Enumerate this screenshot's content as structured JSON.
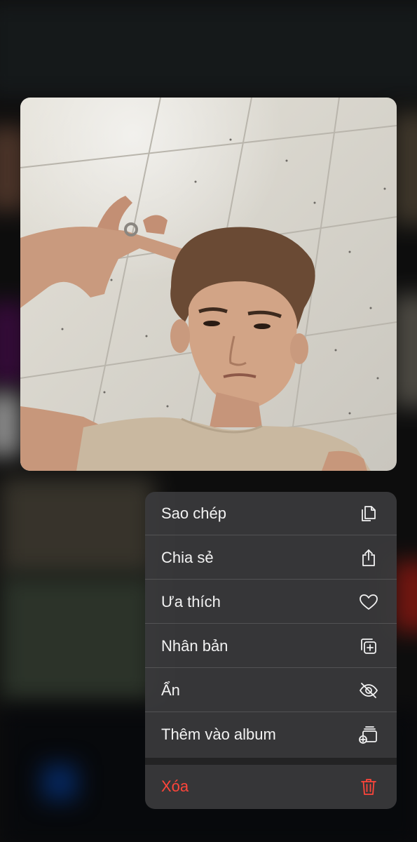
{
  "menu": {
    "items": [
      {
        "label": "Sao chép",
        "icon": "copy-icon"
      },
      {
        "label": "Chia sẻ",
        "icon": "share-icon"
      },
      {
        "label": "Ưa thích",
        "icon": "heart-icon"
      },
      {
        "label": "Nhân bản",
        "icon": "duplicate-icon"
      },
      {
        "label": "Ẩn",
        "icon": "eye-slash-icon"
      },
      {
        "label": "Thêm vào album",
        "icon": "add-to-album-icon"
      }
    ],
    "delete": {
      "label": "Xóa",
      "icon": "trash-icon"
    }
  },
  "colors": {
    "menu_background": "#3a3a3c",
    "menu_text": "#f2f2f2",
    "destructive": "#ff453a"
  }
}
